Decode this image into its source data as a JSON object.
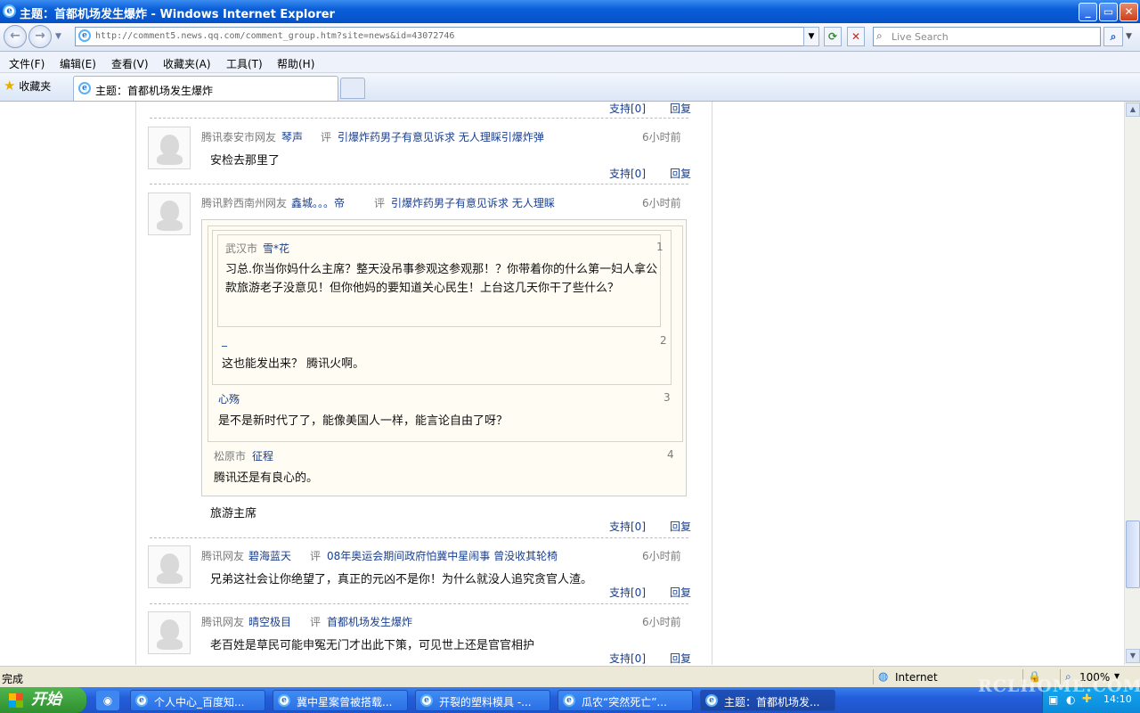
{
  "window": {
    "title": "主题：首都机场发生爆炸 - Windows Internet Explorer",
    "min": "_",
    "max": "▭",
    "close": "✕"
  },
  "nav": {
    "url": "http://comment5.news.qq.com/comment_group.htm?site=news&id=43072746",
    "search_placeholder": "Live Search",
    "back": "←",
    "forward": "→",
    "refresh": "⟳",
    "stop": "✕"
  },
  "menu": [
    "文件(F)",
    "编辑(E)",
    "查看(V)",
    "收藏夹(A)",
    "工具(T)",
    "帮助(H)"
  ],
  "favorites": {
    "label": "收藏夹",
    "tab_title": "主题：首都机场发生爆炸"
  },
  "actions": {
    "support": "支持[0]",
    "reply": "回复",
    "eval": "评"
  },
  "comments": [
    {
      "location": "腾讯泰安市网友",
      "user": "琴声",
      "topic": "引爆炸药男子有意见诉求 无人理睬引爆炸弹",
      "time": "6小时前",
      "text": "安检去那里了"
    },
    {
      "location": "腾讯黔西南州网友",
      "user": "鑫城。。。帝",
      "topic": "引爆炸药男子有意见诉求 无人理睬",
      "time": "6小时前",
      "text": "旅游主席",
      "quotes": [
        {
          "location": "武汉市",
          "user": "雪*花",
          "num": "1",
          "text": "习总.你当你妈什么主席？整天没吊事参观这参观那！？你带着你的什么第一妇人拿公款旅游老子没意见！但你他妈的要知道关心民生！上台这几天你干了些什么？"
        },
        {
          "location": "",
          "user": "_",
          "num": "2",
          "text": "这也能发出来？ 腾讯火啊。"
        },
        {
          "location": "",
          "user": "心殇",
          "num": "3",
          "text": "是不是新时代了了，能像美国人一样，能言论自由了呀？"
        },
        {
          "location": "松原市",
          "user": "征程",
          "num": "4",
          "text": "腾讯还是有良心的。"
        }
      ]
    },
    {
      "location": "腾讯网友",
      "user": "碧海蓝天",
      "topic": "08年奥运会期间政府怕冀中星闹事 曾没收其轮椅",
      "time": "6小时前",
      "text": "兄弟这社会让你绝望了，真正的元凶不是你！为什么就没人追究贪官人渣。"
    },
    {
      "location": "腾讯网友",
      "user": "晴空极目",
      "topic": "首都机场发生爆炸",
      "time": "6小时前",
      "text": "老百姓是草民可能申冤无门才出此下策，可见世上还是官官相护"
    }
  ],
  "status": {
    "text": "完成",
    "zone": "Internet",
    "zoom": "100%"
  },
  "taskbar": {
    "start": "开始",
    "items": [
      "个人中心_百度知...",
      "冀中星案曾被搭载...",
      "开裂的塑料模具 -...",
      "瓜农“突然死亡”...",
      "主题：首都机场发..."
    ],
    "clock": "14:10"
  },
  "watermark": "RCLHOME.COM"
}
